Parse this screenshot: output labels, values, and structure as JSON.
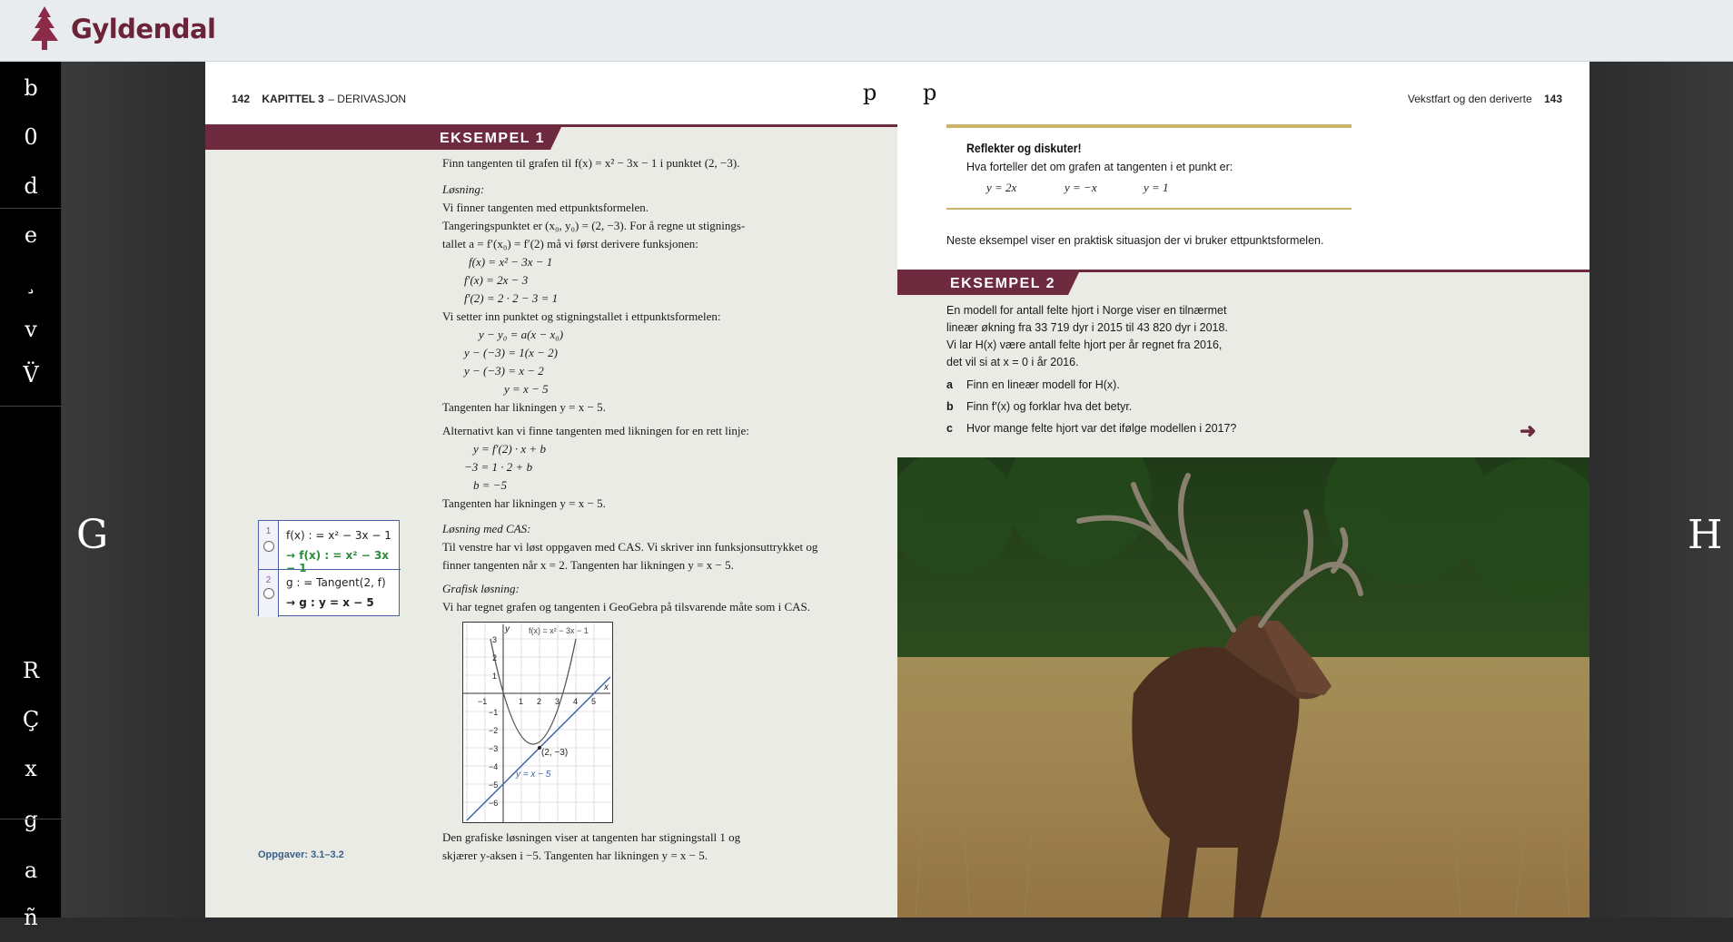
{
  "app": {
    "brand": "Gyldendal",
    "brand_color": "#6b2338"
  },
  "sidebar": {
    "items": [
      {
        "glyph": "b",
        "name": "sidebar-btn-b"
      },
      {
        "glyph": "0",
        "name": "sidebar-btn-0"
      },
      {
        "glyph": "d",
        "name": "sidebar-btn-d"
      },
      {
        "glyph": "e",
        "name": "sidebar-btn-e"
      },
      {
        "glyph": "¸",
        "name": "sidebar-btn-cedilla"
      },
      {
        "glyph": "v",
        "name": "sidebar-btn-v"
      },
      {
        "glyph": "V̈",
        "name": "sidebar-btn-v-dots"
      },
      {
        "glyph": "R",
        "name": "sidebar-btn-r"
      },
      {
        "glyph": "Ç",
        "name": "sidebar-btn-c-cedilla"
      },
      {
        "glyph": "x",
        "name": "sidebar-btn-x"
      },
      {
        "glyph": "g",
        "name": "sidebar-btn-g"
      },
      {
        "glyph": "a",
        "name": "sidebar-btn-a"
      },
      {
        "glyph": "ñ",
        "name": "sidebar-btn-n-tilde"
      }
    ]
  },
  "nav": {
    "prev": "G",
    "next": "H"
  },
  "left_page": {
    "page_number": "142",
    "chapter": "KAPITTEL 3",
    "chapter_topic": "– DERIVASJON",
    "glyph": "p",
    "example_label": "EKSEMPEL 1",
    "lines": [
      "Finn tangenten til grafen til f(x) = x² − 3x − 1 i punktet (2, −3).",
      "Løsning:",
      "Vi finner tangenten med ettpunktsformelen.",
      "Tangeringspunktet er (x₀, y₀) = (2, −3). For å regne ut stignings-",
      "tallet a = f′(x₀) = f′(2) må vi først derivere funksjonen:",
      "f(x) = x² − 3x − 1",
      "f′(x) = 2x − 3",
      "f′(2) = 2 · 2 − 3 = 1",
      "Vi setter inn punktet og stigningstallet i ettpunktsformelen:",
      "y − y₀ = a(x − x₀)",
      "y − (−3) = 1(x − 2)",
      "y − (−3) = x − 2",
      "y = x − 5",
      "Tangenten har likningen y = x − 5.",
      "Alternativt kan vi finne tangenten med likningen for en rett linje:",
      "y = f′(2) · x + b",
      "−3 = 1 · 2 + b",
      "b = −5",
      "Tangenten har likningen y = x − 5.",
      "Løsning med CAS:",
      "Til venstre har vi løst oppgaven med CAS. Vi skriver inn funksjonsuttrykket og",
      "finner tangenten når x = 2. Tangenten har likningen y = x − 5.",
      "Grafisk løsning:",
      "Vi har tegnet grafen og tangenten i GeoGebra på tilsvarende måte som i CAS.",
      "Den grafiske løsningen viser at tangenten har stigningstall 1 og",
      "skjærer y-aksen i −5. Tangenten har likningen y = x − 5."
    ],
    "cas": {
      "row1_num": "1",
      "row1_in": "f(x) : = x² − 3x − 1",
      "row1_out": "→ f(x) : = x² − 3x − 1",
      "row2_num": "2",
      "row2_in": "g : = Tangent(2, f)",
      "row2_out": "→ g : y = x − 5"
    },
    "graph": {
      "func_label": "f(x) = x² − 3x − 1",
      "tangent_label": "y = x − 5",
      "point_label": "(2, −3)",
      "x_axis": "x",
      "y_axis": "y",
      "x_ticks": [
        "−1",
        "1",
        "2",
        "3",
        "4",
        "5"
      ],
      "y_ticks": [
        "3",
        "2",
        "1",
        "−1",
        "−2",
        "−3",
        "−4",
        "−5",
        "−6"
      ]
    },
    "exercises": "Oppgaver: 3.1–3.2"
  },
  "right_page": {
    "page_number": "143",
    "running_head": "Vekstfart og den deriverte",
    "glyph": "p",
    "reflect_title": "Reflekter og diskuter!",
    "reflect_question": "Hva forteller det om grafen at tangenten i et punkt er:",
    "reflect_options": [
      "y = 2x",
      "y = −x",
      "y = 1"
    ],
    "intro": "Neste eksempel viser en praktisk situasjon der vi bruker ettpunktsformelen.",
    "example_label": "EKSEMPEL 2",
    "ex2_lines": [
      "En modell for antall felte hjort i Norge viser en tilnærmet",
      "lineær økning fra 33 719 dyr i 2015 til 43 820 dyr i 2018.",
      "Vi lar H(x) være antall felte hjort per år regnet fra 2016,",
      "det vil si at x = 0 i år 2016."
    ],
    "tasks": [
      {
        "letter": "a",
        "text": "Finn en lineær modell for H(x)."
      },
      {
        "letter": "b",
        "text": "Finn f′(x) og forklar hva det betyr."
      },
      {
        "letter": "c",
        "text": "Hvor mange felte hjort var det ifølge modellen i 2017?"
      }
    ],
    "arrow_icon": "arrow-right-icon"
  },
  "colors": {
    "accent": "#6e2a3e",
    "page_bg": "#e9ebe4",
    "gold": "#c9b46a"
  }
}
